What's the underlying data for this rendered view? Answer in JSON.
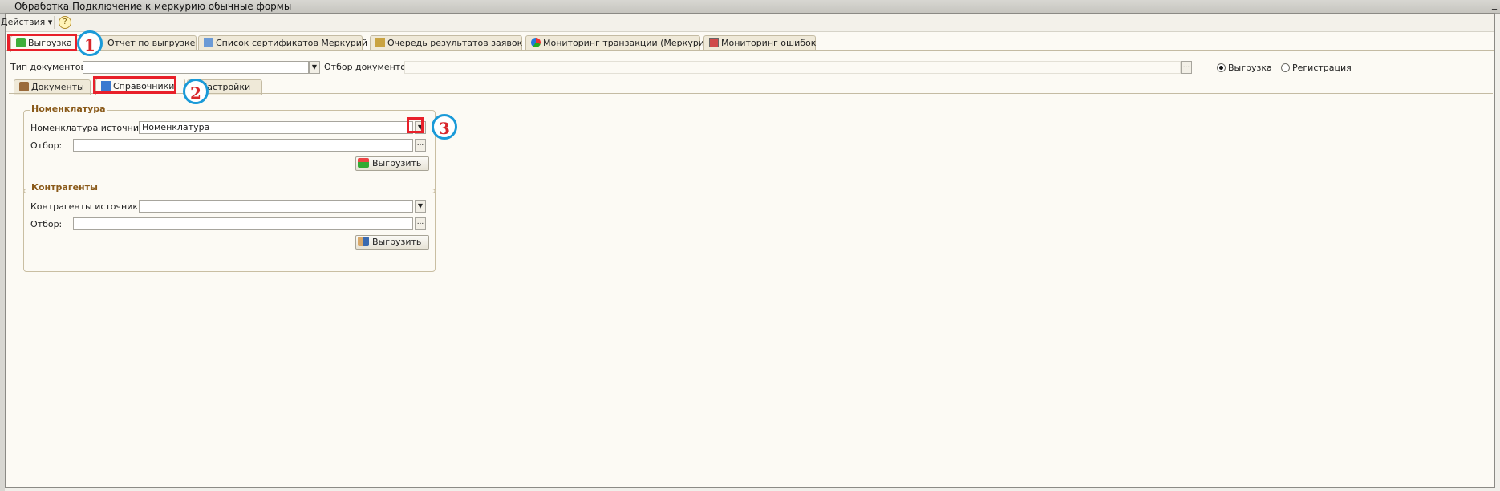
{
  "window": {
    "title": "Обработка  Подключение к меркурию обычные формы",
    "corner_button": "_"
  },
  "toolbar": {
    "actions_label": "Действия ▾",
    "help_label": "?"
  },
  "top_tabs": [
    {
      "label": "Выгрузка",
      "icon": "export-icon"
    },
    {
      "label": "Отчет по выгрузке",
      "icon": "report-icon"
    },
    {
      "label": "Список сертификатов Меркурий",
      "icon": "certificates-icon"
    },
    {
      "label": "Очередь результатов заявок",
      "icon": "queue-icon"
    },
    {
      "label": "Мониторинг транзакции (Меркурий)",
      "icon": "pie-chart-icon"
    },
    {
      "label": "Мониторинг ошибок",
      "icon": "monitor-icon"
    }
  ],
  "filters": {
    "doc_type_label": "Тип документов:",
    "doc_type_value": "",
    "doc_filter_label": "Отбор документов:",
    "doc_filter_value": "",
    "radio_export": "Выгрузка",
    "radio_register": "Регистрация",
    "selected_radio": "Выгрузка"
  },
  "sub_tabs": [
    {
      "label": "Документы",
      "icon": "briefcase-icon"
    },
    {
      "label": "Справочники",
      "icon": "directory-icon"
    },
    {
      "label": "Настройки",
      "icon": "settings-icon"
    }
  ],
  "nomenclature": {
    "title": "Номенклатура",
    "source_label": "Номенклатура источник:",
    "source_value": "Номенклатура",
    "filter_label": "Отбор:",
    "filter_value": "",
    "export_button": "Выгрузить"
  },
  "counterparties": {
    "title": "Контрагенты",
    "source_label": "Контрагенты источник:",
    "source_value": "",
    "filter_label": "Отбор:",
    "filter_value": "",
    "export_button": "Выгрузить"
  },
  "annotations": [
    "1",
    "2",
    "3"
  ],
  "colors": {
    "highlight": "#e8202a",
    "callout_ring": "#1a9ad8",
    "group_title": "#8a5a1a"
  }
}
